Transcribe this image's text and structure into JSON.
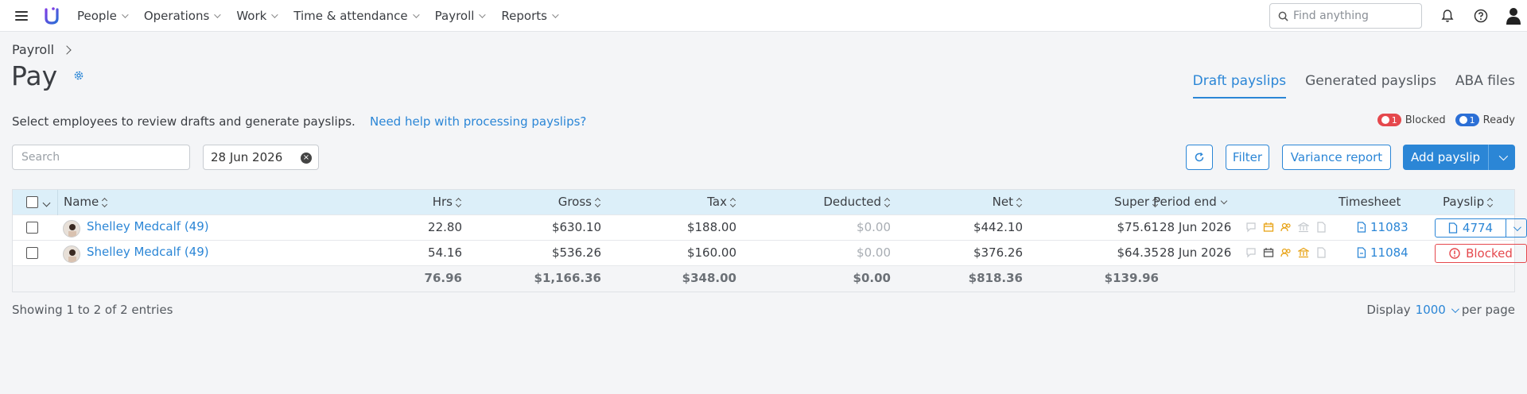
{
  "nav": {
    "items": [
      {
        "label": "People"
      },
      {
        "label": "Operations"
      },
      {
        "label": "Work"
      },
      {
        "label": "Time & attendance"
      },
      {
        "label": "Payroll"
      },
      {
        "label": "Reports"
      }
    ],
    "search_placeholder": "Find anything"
  },
  "header": {
    "breadcrumb": "Payroll",
    "title": "Pay",
    "tabs": [
      {
        "label": "Draft payslips",
        "active": true
      },
      {
        "label": "Generated payslips",
        "active": false
      },
      {
        "label": "ABA files",
        "active": false
      }
    ],
    "subtext": "Select employees to review drafts and generate payslips.",
    "help_link": "Need help with processing payslips?",
    "legend": {
      "blocked_count": "1",
      "blocked_label": "Blocked",
      "ready_count": "1",
      "ready_label": "Ready"
    }
  },
  "toolbar": {
    "search_placeholder": "Search",
    "date": "28 Jun 2026",
    "filter_label": "Filter",
    "variance_label": "Variance report",
    "add_payslip_label": "Add payslip"
  },
  "table": {
    "columns": {
      "name": "Name",
      "hrs": "Hrs",
      "gross": "Gross",
      "tax": "Tax",
      "deducted": "Deducted",
      "net": "Net",
      "super": "Super",
      "period_end": "Period end",
      "timesheet": "Timesheet",
      "payslip": "Payslip"
    },
    "rows": [
      {
        "name": "Shelley Medcalf (49)",
        "hrs": "22.80",
        "gross": "$630.10",
        "tax": "$188.00",
        "deducted": "$0.00",
        "net": "$442.10",
        "super": "$75.61",
        "period_end": "28 Jun 2026",
        "timesheet": "11083",
        "payslip": "4774",
        "status": "ready"
      },
      {
        "name": "Shelley Medcalf (49)",
        "hrs": "54.16",
        "gross": "$536.26",
        "tax": "$160.00",
        "deducted": "$0.00",
        "net": "$376.26",
        "super": "$64.35",
        "period_end": "28 Jun 2026",
        "timesheet": "11084",
        "payslip": "Blocked",
        "status": "blocked"
      }
    ],
    "totals": {
      "hrs": "76.96",
      "gross": "$1,166.36",
      "tax": "$348.00",
      "deducted": "$0.00",
      "net": "$818.36",
      "super": "$139.96"
    }
  },
  "footer": {
    "showing": "Showing 1 to 2 of 2 entries",
    "display_label": "Display",
    "display_value": "1000",
    "per_page": "per page"
  },
  "colors": {
    "accent": "#2b86d6",
    "blocked": "#e5484d",
    "header_row": "#dceff9",
    "warning_icon": "#e8a317"
  }
}
